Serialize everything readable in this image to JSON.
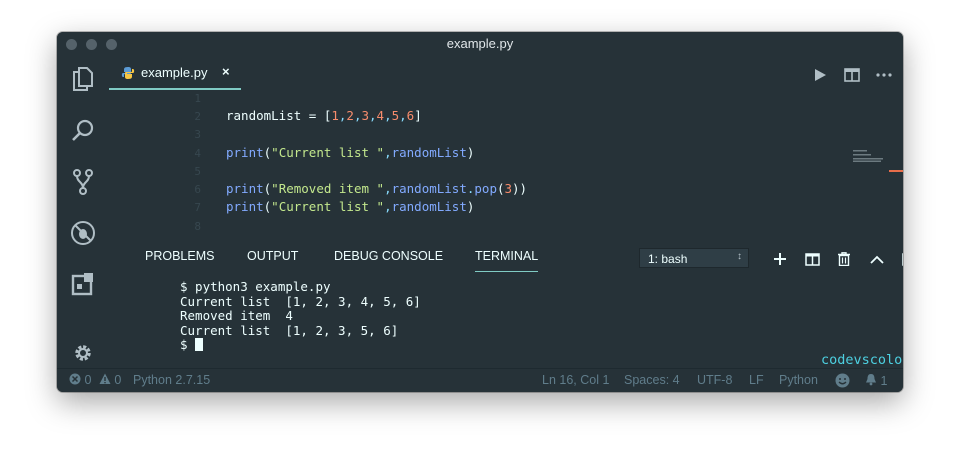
{
  "window": {
    "title": "example.py"
  },
  "tab": {
    "filename": "example.py",
    "close_glyph": "×"
  },
  "editor": {
    "lines": [
      {
        "n": "1",
        "segs": []
      },
      {
        "n": "2",
        "segs": [
          {
            "t": "randomList = [",
            "c": "#eeffff"
          },
          {
            "t": "1",
            "c": "#f78c6c"
          },
          {
            "t": ",",
            "c": "#89ddff"
          },
          {
            "t": "2",
            "c": "#f78c6c"
          },
          {
            "t": ",",
            "c": "#89ddff"
          },
          {
            "t": "3",
            "c": "#f78c6c"
          },
          {
            "t": ",",
            "c": "#89ddff"
          },
          {
            "t": "4",
            "c": "#f78c6c"
          },
          {
            "t": ",",
            "c": "#89ddff"
          },
          {
            "t": "5",
            "c": "#f78c6c"
          },
          {
            "t": ",",
            "c": "#89ddff"
          },
          {
            "t": "6",
            "c": "#f78c6c"
          },
          {
            "t": "]",
            "c": "#eeffff"
          }
        ]
      },
      {
        "n": "3",
        "segs": []
      },
      {
        "n": "4",
        "segs": [
          {
            "t": "print",
            "c": "#82aaff"
          },
          {
            "t": "(",
            "c": "#eeffff"
          },
          {
            "t": "\"Current list \"",
            "c": "#c3e88d"
          },
          {
            "t": ",",
            "c": "#89ddff"
          },
          {
            "t": "randomList",
            "c": "#82aaff"
          },
          {
            "t": ")",
            "c": "#eeffff"
          }
        ]
      },
      {
        "n": "5",
        "segs": []
      },
      {
        "n": "6",
        "segs": [
          {
            "t": "print",
            "c": "#82aaff"
          },
          {
            "t": "(",
            "c": "#eeffff"
          },
          {
            "t": "\"Removed item \"",
            "c": "#c3e88d"
          },
          {
            "t": ",",
            "c": "#89ddff"
          },
          {
            "t": "randomList",
            "c": "#82aaff"
          },
          {
            "t": ".",
            "c": "#89ddff"
          },
          {
            "t": "pop",
            "c": "#82aaff"
          },
          {
            "t": "(",
            "c": "#eeffff"
          },
          {
            "t": "3",
            "c": "#f78c6c"
          },
          {
            "t": "))",
            "c": "#eeffff"
          }
        ]
      },
      {
        "n": "7",
        "segs": [
          {
            "t": "print",
            "c": "#82aaff"
          },
          {
            "t": "(",
            "c": "#eeffff"
          },
          {
            "t": "\"Current list \"",
            "c": "#c3e88d"
          },
          {
            "t": ",",
            "c": "#89ddff"
          },
          {
            "t": "randomList",
            "c": "#82aaff"
          },
          {
            "t": ")",
            "c": "#eeffff"
          }
        ]
      },
      {
        "n": "8",
        "segs": []
      }
    ]
  },
  "panel": {
    "tabs": [
      "PROBLEMS",
      "OUTPUT",
      "DEBUG CONSOLE",
      "TERMINAL"
    ],
    "active_tab": "TERMINAL",
    "terminal_select": "1: bash",
    "select_chevron": "↕",
    "terminal_lines": [
      "$ python3 example.py",
      "Current list  [1, 2, 3, 4, 5, 6]",
      "Removed item  4",
      "Current list  [1, 2, 3, 5, 6]"
    ],
    "prompt": "$ "
  },
  "watermark": "codevscolor.com",
  "status": {
    "errors": "0",
    "warnings": "0",
    "interpreter": "Python 2.7.15",
    "position": "Ln 16, Col 1",
    "spaces": "Spaces: 4",
    "encoding": "UTF-8",
    "eol": "LF",
    "language": "Python",
    "notifications": "1"
  },
  "colors": {
    "background": "#263238",
    "accent": "#80cbc4",
    "foreground": "#eeffff"
  },
  "icons": [
    "files-icon",
    "search-icon",
    "source-control-icon",
    "debug-icon",
    "extensions-icon",
    "gear-icon",
    "python-file-icon",
    "run-icon",
    "split-editor-icon",
    "more-icon",
    "plus-icon",
    "split-terminal-icon",
    "trash-icon",
    "chevron-up-icon",
    "maximize-panel-icon",
    "close-panel-icon",
    "error-icon",
    "warning-icon",
    "smiley-icon",
    "bell-icon"
  ]
}
